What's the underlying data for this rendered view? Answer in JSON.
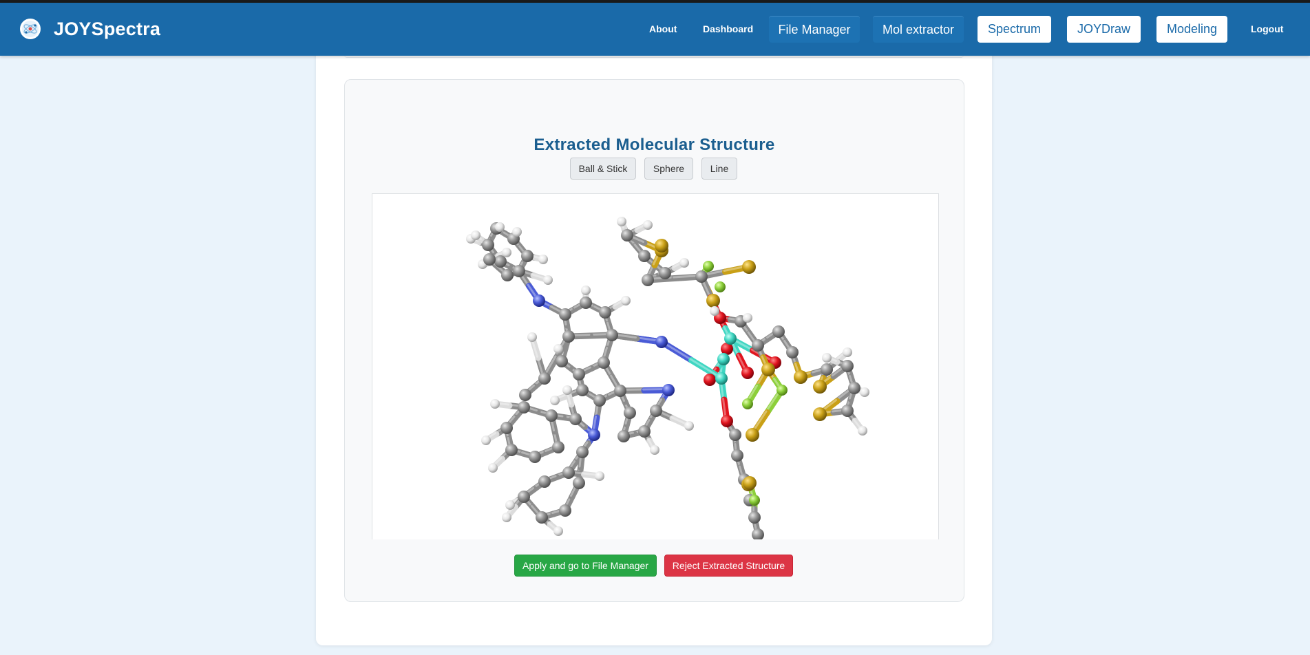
{
  "header": {
    "brand": "JOYSpectra",
    "logo_icon": "atom-icon",
    "nav": {
      "about": "About",
      "dashboard": "Dashboard",
      "file_manager": "File Manager",
      "mol_extractor": "Mol extractor",
      "spectrum": "Spectrum",
      "joydraw": "JOYDraw",
      "modeling": "Modeling",
      "logout": "Logout"
    }
  },
  "panel": {
    "title": "Extracted Molecular Structure",
    "style_buttons": {
      "ball_stick": "Ball & Stick",
      "sphere": "Sphere",
      "line": "Line"
    },
    "actions": {
      "apply": "Apply and go to File Manager",
      "reject": "Reject Extracted Structure"
    }
  },
  "colors": {
    "navbar": "#1a6aa9",
    "page_background": "#eaf3fb",
    "title": "#1b5e8f",
    "apply_button": "#28a745",
    "reject_button": "#dc3545",
    "carbon": "#8c8c8c",
    "hydrogen": "#f0f0f0",
    "nitrogen": "#4a5bd6",
    "oxygen": "#e0141e",
    "sulfur": "#c9a017",
    "fluorine": "#8ccf3a",
    "metal": "#3fd6c2"
  }
}
